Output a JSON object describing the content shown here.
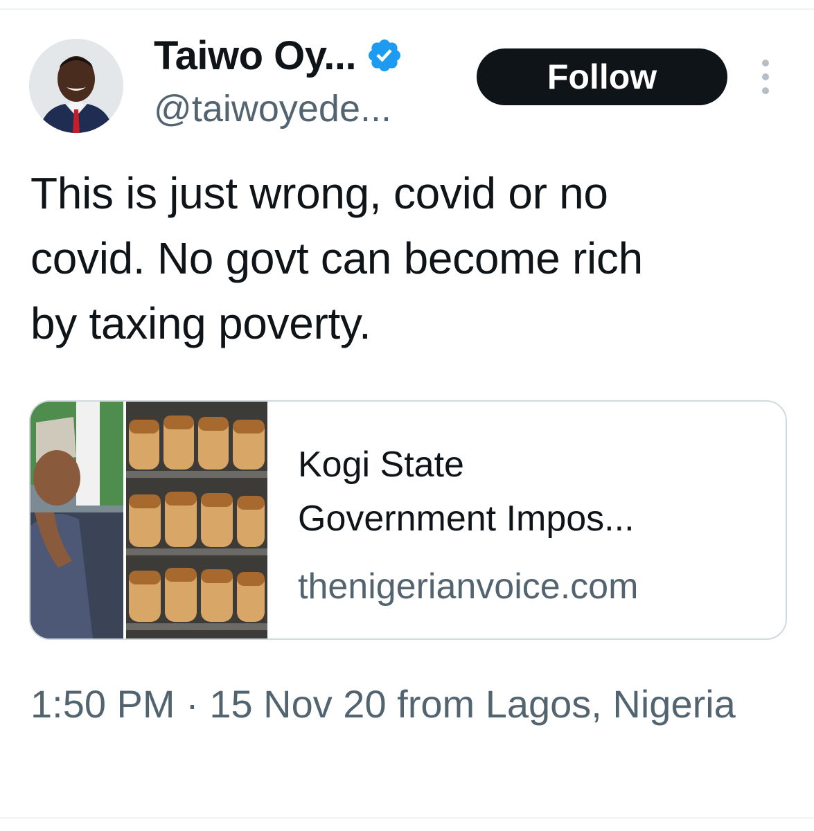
{
  "author": {
    "display_name": "Taiwo Oy...",
    "handle": "@taiwoyede...",
    "verified": true,
    "avatar_icon": "profile-photo"
  },
  "actions": {
    "follow_label": "Follow",
    "more_icon": "more-dots-vertical-icon"
  },
  "tweet": {
    "text": "This is just wrong, covid or no\ncovid. No govt can become rich\nby taxing poverty."
  },
  "link_card": {
    "title": "Kogi State\nGovernment Impos...",
    "domain": "thenigerianvoice.com",
    "media": [
      "person-photo",
      "bread-loaves-photo"
    ]
  },
  "meta": {
    "timestamp": "1:50 PM · 15 Nov 20 from Lagos, Nigeria"
  },
  "colors": {
    "text_primary": "#0f1419",
    "text_secondary": "#536471",
    "verified_blue": "#1d9bf0",
    "button_black": "#0f1419",
    "border": "#cfd9de"
  }
}
